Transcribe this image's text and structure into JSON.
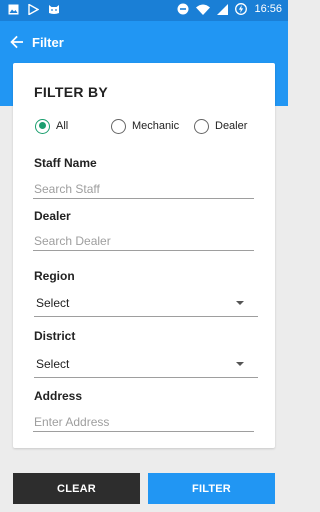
{
  "status_bar": {
    "time": "16:56",
    "icons": [
      "image-icon",
      "play-store-icon",
      "cat-icon",
      "minus-circle-icon",
      "wifi-icon",
      "signal-icon",
      "battery-charging-icon"
    ],
    "color": "#1a7fd6"
  },
  "app_bar": {
    "title": "Filter",
    "back_icon": "arrow-left-icon",
    "color": "#2196f3"
  },
  "card": {
    "title": "FILTER BY",
    "radio_options": [
      {
        "label": "All",
        "checked": true
      },
      {
        "label": "Mechanic",
        "checked": false
      },
      {
        "label": "Dealer",
        "checked": false
      }
    ],
    "accent_color": "#1a9e6e",
    "fields": {
      "staff_name": {
        "label": "Staff Name",
        "placeholder": "Search Staff",
        "value": ""
      },
      "dealer": {
        "label": "Dealer",
        "placeholder": "Search Dealer",
        "value": ""
      },
      "region": {
        "label": "Region",
        "selected": "Select"
      },
      "district": {
        "label": "District",
        "selected": "Select"
      },
      "address": {
        "label": "Address",
        "placeholder": "Enter Address",
        "value": ""
      }
    }
  },
  "buttons": {
    "clear_label": "CLEAR",
    "filter_label": "FILTER"
  }
}
